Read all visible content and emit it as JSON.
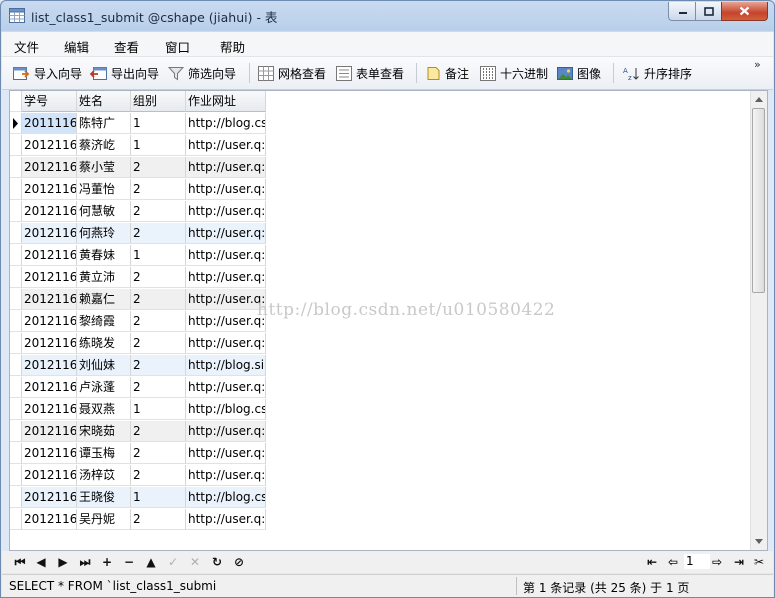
{
  "window": {
    "title": "list_class1_submit @cshape (jiahui) - 表"
  },
  "menu": [
    "文件",
    "编辑",
    "查看",
    "窗口",
    "帮助"
  ],
  "toolbar": {
    "import_wizard": "导入向导",
    "export_wizard": "导出向导",
    "filter_wizard": "筛选向导",
    "grid_view": "网格查看",
    "form_view": "表单查看",
    "memo": "备注",
    "hex": "十六进制",
    "image": "图像",
    "sort_asc": "升序排序",
    "more": "»"
  },
  "table": {
    "columns": [
      "学号",
      "姓名",
      "组别",
      "作业网址"
    ],
    "rows": [
      [
        "2011116",
        "陈特广",
        "1",
        "http://blog.cs"
      ],
      [
        "2012116",
        "蔡济屹",
        "1",
        "http://user.q:"
      ],
      [
        "2012116",
        "蔡小莹",
        "2",
        "http://user.q:"
      ],
      [
        "2012116",
        "冯董怡",
        "2",
        "http://user.q:"
      ],
      [
        "2012116",
        "何慧敏",
        "2",
        "http://user.q:"
      ],
      [
        "2012116",
        "何燕玲",
        "2",
        "http://user.q:"
      ],
      [
        "2012116",
        "黄春妹",
        "1",
        "http://user.q:"
      ],
      [
        "2012116",
        "黄立沛",
        "2",
        "http://user.q:"
      ],
      [
        "2012116",
        "赖嘉仁",
        "2",
        "http://user.q:"
      ],
      [
        "2012116",
        "黎绮霞",
        "2",
        "http://user.q:"
      ],
      [
        "2012116",
        "练晓发",
        "2",
        "http://user.q:"
      ],
      [
        "2012116",
        "刘仙妹",
        "2",
        "http://blog.si"
      ],
      [
        "2012116",
        "卢泳蓬",
        "2",
        "http://user.q:"
      ],
      [
        "2012116",
        "聂双燕",
        "1",
        "http://blog.cs"
      ],
      [
        "2012116",
        "宋晓茹",
        "2",
        "http://user.q:"
      ],
      [
        "2012116",
        "谭玉梅",
        "2",
        "http://user.q:"
      ],
      [
        "2012116",
        "汤梓苡",
        "2",
        "http://user.q:"
      ],
      [
        "2012116",
        "王晓俊",
        "1",
        "http://blog.cs"
      ],
      [
        "2012116",
        "吴丹妮",
        "2",
        "http://user.q:"
      ]
    ],
    "current_row": 0
  },
  "watermark": "http://blog.csdn.net/u010580422",
  "nav": {
    "page": "1"
  },
  "status": {
    "sql": "SELECT * FROM `list_class1_submi",
    "records": "第 1 条记录 (共 25 条) 于 1 页"
  },
  "colors": {
    "accent": "#3b6fb6",
    "selection": "#d2e4fa",
    "alt_row": "#f0f0f0"
  }
}
